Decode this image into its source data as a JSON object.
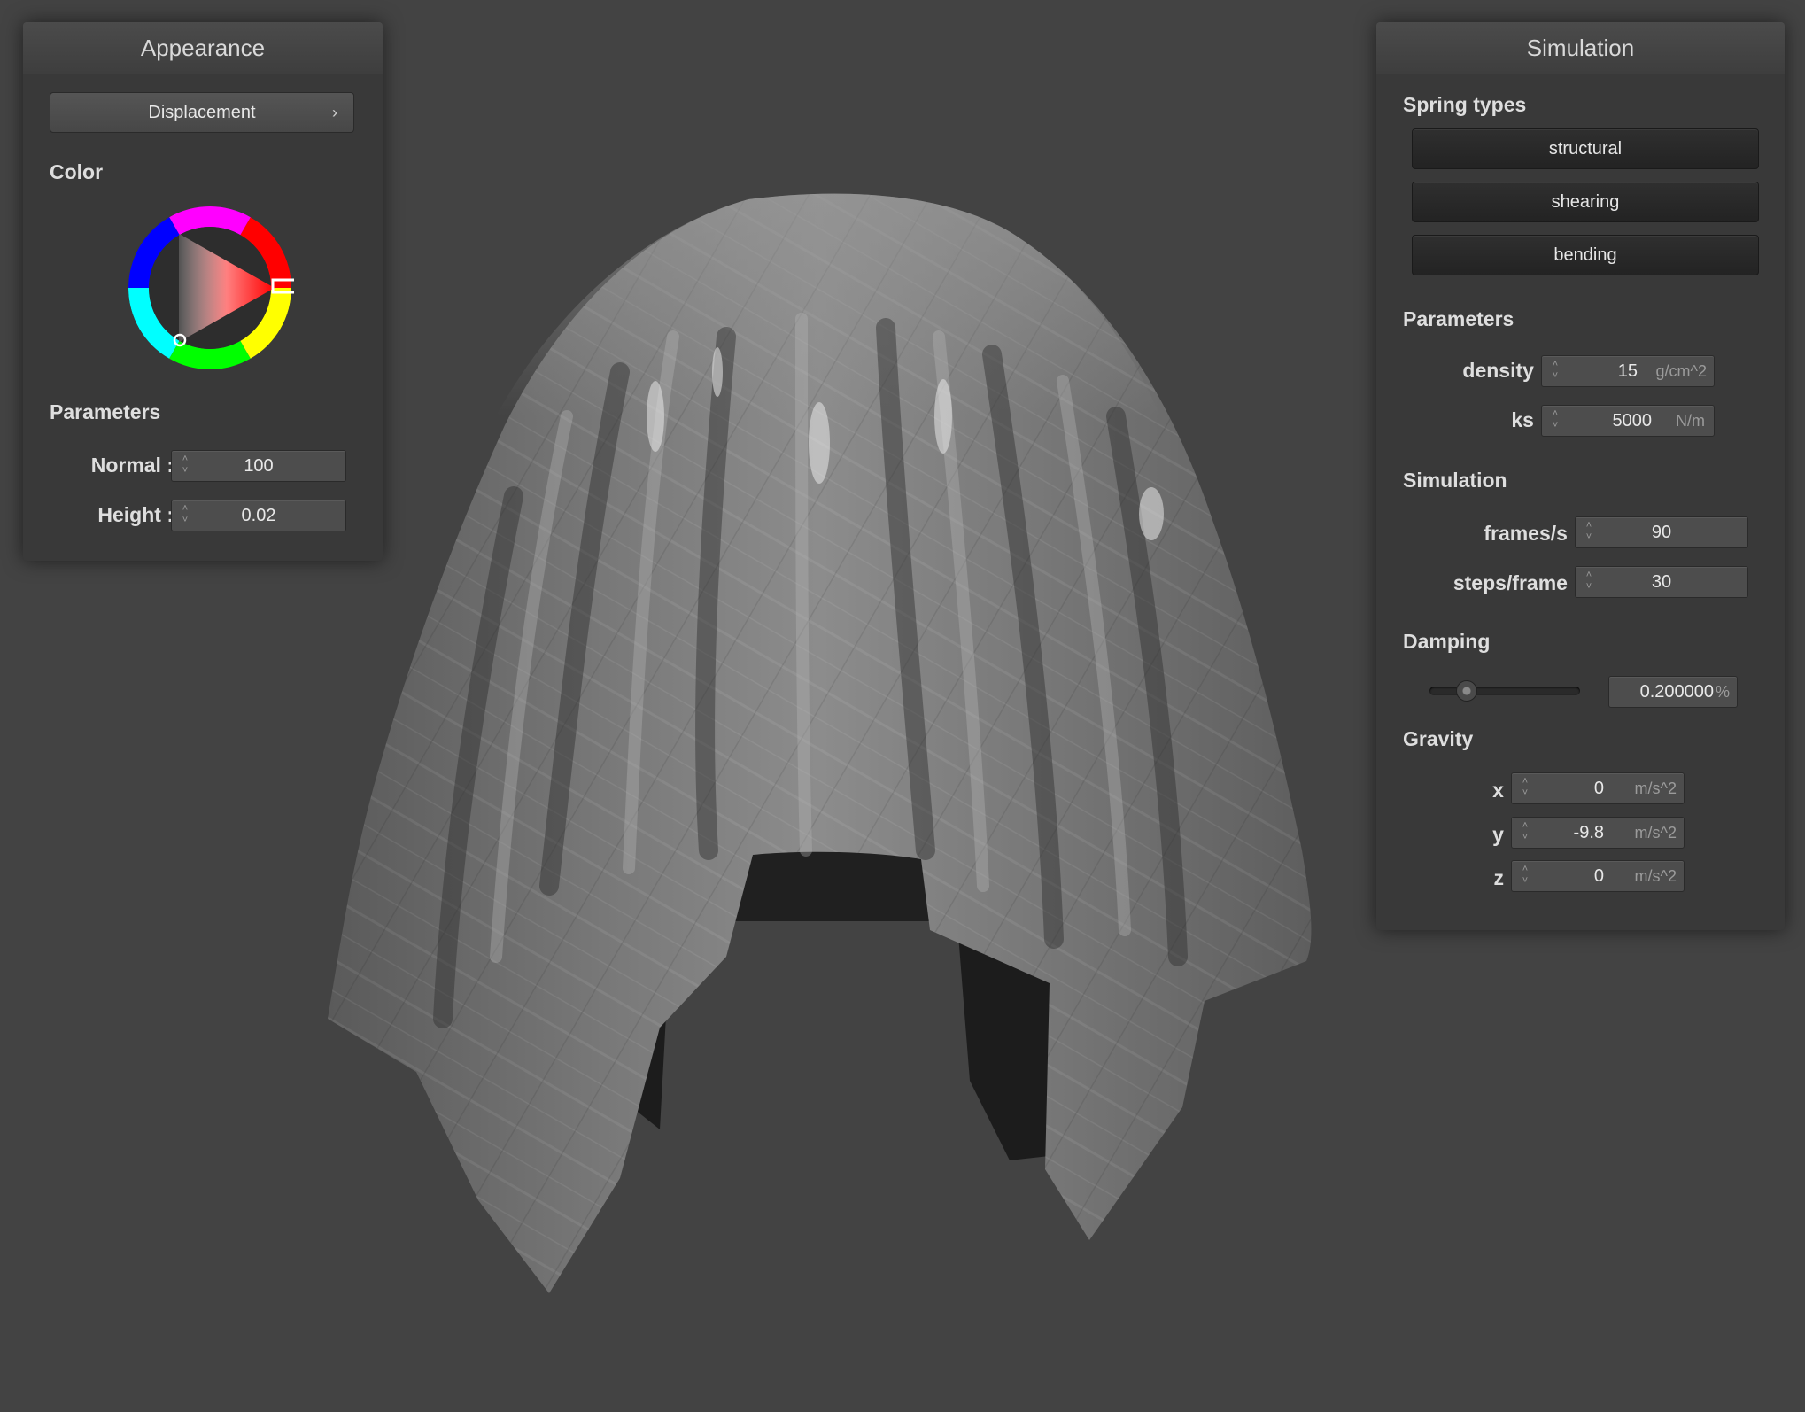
{
  "appearance": {
    "title": "Appearance",
    "texture_button": "Displacement",
    "color_label": "Color",
    "color_value": "#ff0000",
    "params_label": "Parameters",
    "normal": {
      "label": "Normal :",
      "value": "100"
    },
    "height": {
      "label": "Height :",
      "value": "0.02"
    }
  },
  "simulation": {
    "title": "Simulation",
    "spring_label": "Spring types",
    "springs": [
      "structural",
      "shearing",
      "bending"
    ],
    "params_label": "Parameters",
    "density": {
      "label": "density :",
      "value": "15",
      "unit": "g/cm^2"
    },
    "ks": {
      "label": "ks :",
      "value": "5000",
      "unit": "N/m"
    },
    "sim_label": "Simulation",
    "fps": {
      "label": "frames/s :",
      "value": "90"
    },
    "steps": {
      "label": "steps/frame :",
      "value": "30"
    },
    "damping_label": "Damping",
    "damping": {
      "value": "0.200000",
      "unit": "%",
      "slider_fraction": 0.2
    },
    "gravity_label": "Gravity",
    "gx": {
      "label": "x :",
      "value": "0",
      "unit": "m/s^2"
    },
    "gy": {
      "label": "y :",
      "value": "-9.8",
      "unit": "m/s^2"
    },
    "gz": {
      "label": "z :",
      "value": "0",
      "unit": "m/s^2"
    }
  }
}
